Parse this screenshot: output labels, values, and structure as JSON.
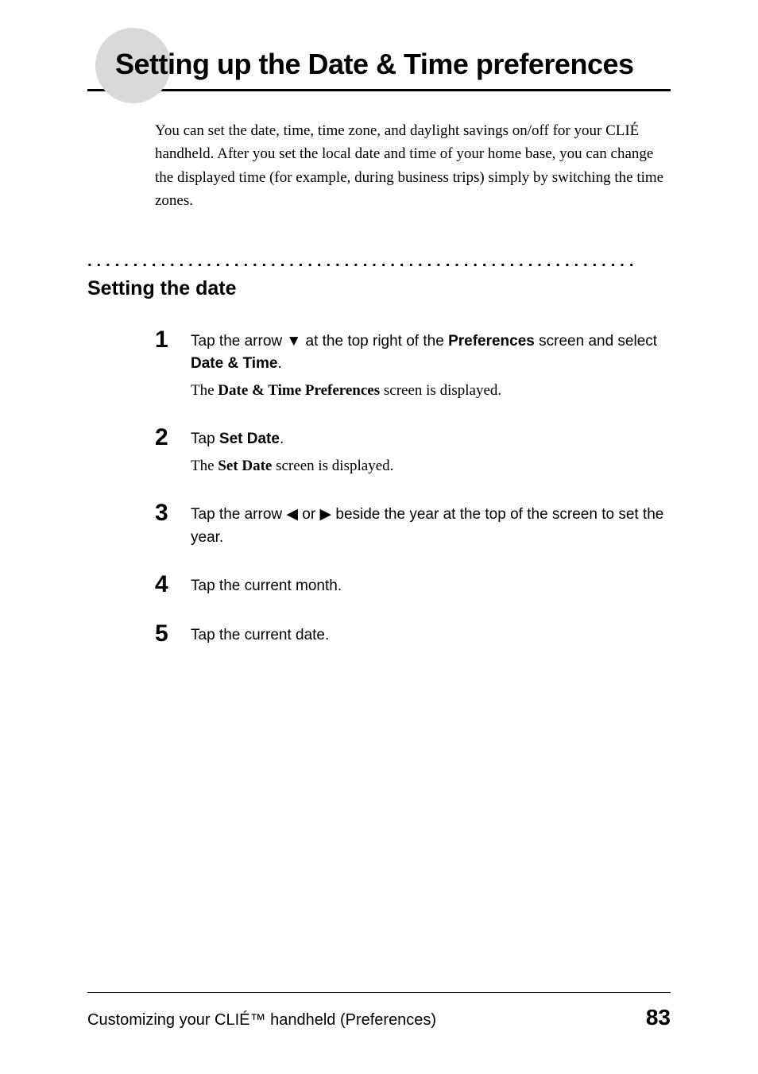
{
  "page": {
    "title": "Setting up the Date & Time preferences",
    "intro": "You can set the date, time, time zone, and daylight savings on/off for your CLIÉ handheld. After you set the local date and time of your home base, you can change the displayed time (for example, during business trips) simply by switching the time zones."
  },
  "section": {
    "dots": "............................................................",
    "heading": "Setting the date"
  },
  "steps": [
    {
      "num": "1",
      "instr_pre": "Tap the arrow ",
      "instr_tri": "▼",
      "instr_mid": " at the top right of the ",
      "instr_bold1": "Preferences",
      "instr_mid2": " screen and select ",
      "instr_bold2": "Date & Time",
      "instr_post": ".",
      "note_pre": "The ",
      "note_bold": "Date & Time Preferences",
      "note_post": " screen is displayed."
    },
    {
      "num": "2",
      "instr_pre": "Tap ",
      "instr_bold1": "Set Date",
      "instr_post": ".",
      "note_pre": "The ",
      "note_bold": "Set Date",
      "note_post": " screen is displayed."
    },
    {
      "num": "3",
      "instr_pre": "Tap the arrow ",
      "instr_tri1": "◀",
      "instr_mid": " or ",
      "instr_tri2": "▶",
      "instr_post": " beside the year at the top of the screen to set the year."
    },
    {
      "num": "4",
      "instr": "Tap the current month."
    },
    {
      "num": "5",
      "instr": "Tap the current date."
    }
  ],
  "footer": {
    "left": "Customizing your CLIÉ™ handheld (Preferences)",
    "page": "83"
  }
}
